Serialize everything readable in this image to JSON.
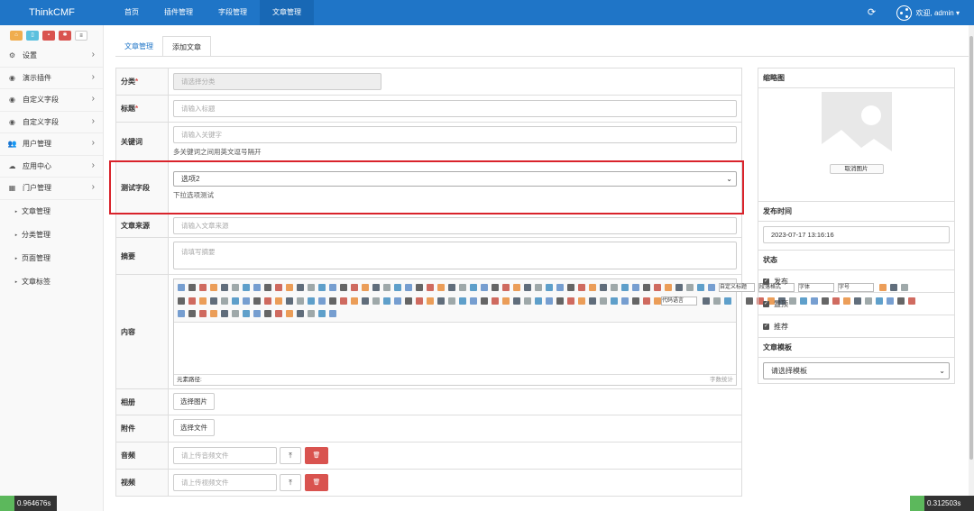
{
  "app": {
    "logo": "ThinkCMF",
    "user": "欢迎, admin ▾"
  },
  "topnav": [
    "首页",
    "插件管理",
    "字段管理",
    "文章管理"
  ],
  "sidebar": {
    "items": [
      {
        "label": "设置",
        "icon": "gear-icon"
      },
      {
        "label": "演示插件",
        "icon": "dashboard-icon"
      },
      {
        "label": "自定义字段",
        "icon": "dashboard-icon"
      },
      {
        "label": "自定义字段",
        "icon": "dashboard-icon"
      },
      {
        "label": "用户管理",
        "icon": "users-icon"
      },
      {
        "label": "应用中心",
        "icon": "cloud-icon"
      },
      {
        "label": "门户管理",
        "icon": "grid-icon"
      }
    ],
    "subitems": [
      "文章管理",
      "分类管理",
      "页面管理",
      "文章标签"
    ]
  },
  "tabs": [
    "文章管理",
    "添加文章"
  ],
  "form": {
    "category": {
      "label": "分类",
      "placeholder": "请选择分类"
    },
    "title": {
      "label": "标题",
      "placeholder": "请输入标题"
    },
    "keywords": {
      "label": "关键词",
      "placeholder": "请输入关键字",
      "help": "多关键词之间用英文逗号隔开"
    },
    "test": {
      "label": "测试字段",
      "value": "选项2",
      "help": "下拉选项测试"
    },
    "source": {
      "label": "文章来源",
      "placeholder": "请输入文章来源"
    },
    "summary": {
      "label": "摘要",
      "placeholder": "请填写摘要"
    },
    "content": {
      "label": "内容",
      "path": "元素路径:",
      "wordcount": "字数统计",
      "dd1": "自定义标题",
      "dd2": "段落格式",
      "dd3": "字体",
      "dd4": "字号",
      "dd5": "代码语言"
    },
    "album": {
      "label": "相册",
      "button": "选择图片"
    },
    "attachment": {
      "label": "附件",
      "button": "选择文件"
    },
    "audio": {
      "label": "音频",
      "placeholder": "请上传音频文件"
    },
    "video": {
      "label": "视频",
      "placeholder": "请上传视频文件"
    }
  },
  "right": {
    "thumb_title": "缩略图",
    "cancel": "取消图片",
    "pubtime_title": "发布时间",
    "pubtime": "2023-07-17 13:16:16",
    "status_title": "状态",
    "status": [
      "发布",
      "置顶",
      "推荐"
    ],
    "template_title": "文章模板",
    "template_placeholder": "请选择模板"
  },
  "timers": {
    "left": "0.964676s",
    "right": "0.312503s"
  },
  "colors": {
    "primary": "#1f75c7",
    "danger": "#d9534f",
    "highlight": "#d9232b"
  }
}
